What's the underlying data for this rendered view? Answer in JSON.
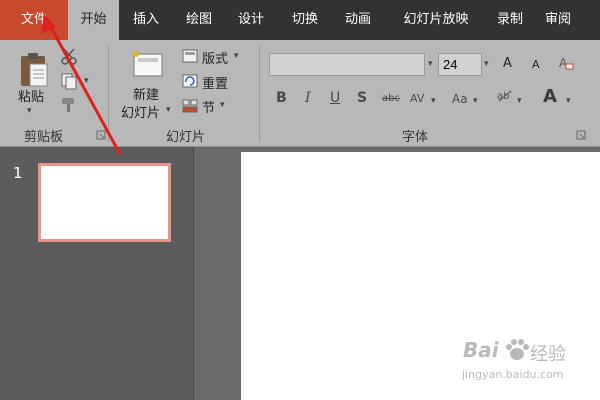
{
  "tabs": [
    {
      "label": "文件"
    },
    {
      "label": "开始"
    },
    {
      "label": "插入"
    },
    {
      "label": "绘图"
    },
    {
      "label": "设计"
    },
    {
      "label": "切换"
    },
    {
      "label": "动画"
    },
    {
      "label": "幻灯片放映"
    },
    {
      "label": "录制"
    },
    {
      "label": "审阅"
    }
  ],
  "clipboard": {
    "paste_label": "粘贴",
    "group_label": "剪贴板"
  },
  "slides": {
    "new_slide_line1": "新建",
    "new_slide_line2": "幻灯片",
    "layout_label": "版式",
    "reset_label": "重置",
    "section_label": "节",
    "group_label": "幻灯片"
  },
  "font": {
    "font_name": "",
    "font_size": "24",
    "grow_label": "A",
    "shrink_label": "A",
    "bold": "B",
    "italic": "I",
    "underline": "U",
    "shadow": "S",
    "strike": "abc",
    "spacing": "AV",
    "case": "Aa",
    "color_a": "A",
    "group_label": "字体"
  },
  "slide_panel": {
    "number": "1"
  },
  "watermark": {
    "brand": "Bai",
    "brand2": "经验",
    "url": "jingyan.baidu.com"
  },
  "colors": {
    "file_tab": "#c84a2c",
    "accent_pink": "#e8948a",
    "arrow": "#e02020",
    "tabbar": "#323232"
  }
}
